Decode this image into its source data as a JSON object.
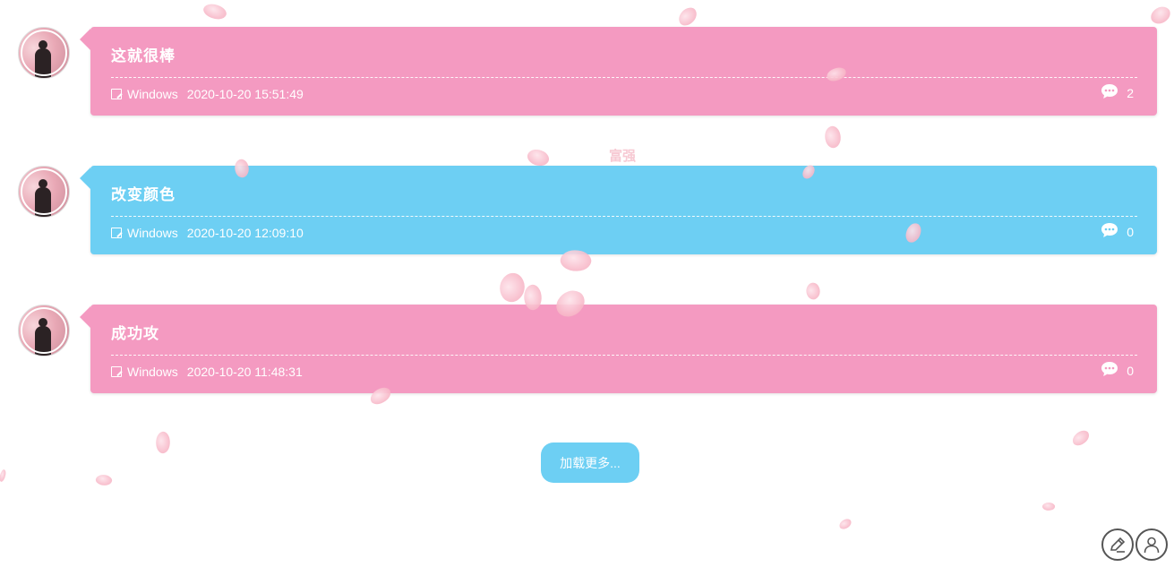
{
  "colors": {
    "pink": "#f49ac1",
    "blue": "#6dcff3",
    "petal": "#f8bccb",
    "watermark": "#f7c9d3"
  },
  "watermark_text": "富强",
  "posts": [
    {
      "title": "这就很棒",
      "device": "Windows",
      "timestamp": "2020-10-20 15:51:49",
      "comment_count": "2",
      "color": "pink",
      "avatar_icon": "avatar-image"
    },
    {
      "title": "改变颜色",
      "device": "Windows",
      "timestamp": "2020-10-20 12:09:10",
      "comment_count": "0",
      "color": "blue",
      "avatar_icon": "avatar-image"
    },
    {
      "title": "成功攻",
      "device": "Windows",
      "timestamp": "2020-10-20 11:48:31",
      "comment_count": "0",
      "color": "pink",
      "avatar_icon": "avatar-image"
    }
  ],
  "load_more_label": "加载更多...",
  "corner_buttons": {
    "write_icon": "edit-post-icon",
    "user_icon": "user-profile-icon"
  }
}
